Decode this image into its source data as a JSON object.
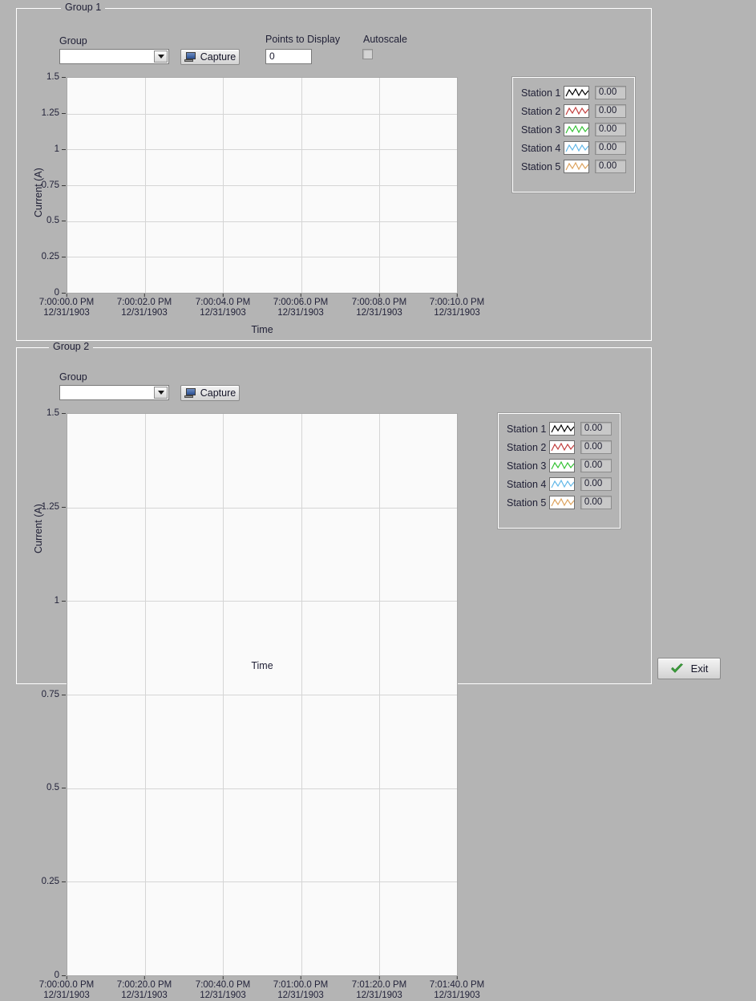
{
  "groups": [
    {
      "frame_label": "Group 1",
      "group_label": "Group",
      "group_value": "",
      "capture_label": "Capture",
      "points_label": "Points to Display",
      "points_value": "0",
      "autoscale_label": "Autoscale",
      "autoscale_checked": false,
      "chart": {
        "ylabel": "Current (A)",
        "xlabel": "Time",
        "yticks": [
          "1.5",
          "1.25",
          "1",
          "0.75",
          "0.5",
          "0.25",
          "0"
        ],
        "xticks": [
          {
            "time": "7:00:00.0 PM",
            "date": "12/31/1903"
          },
          {
            "time": "7:00:02.0 PM",
            "date": "12/31/1903"
          },
          {
            "time": "7:00:04.0 PM",
            "date": "12/31/1903"
          },
          {
            "time": "7:00:06.0 PM",
            "date": "12/31/1903"
          },
          {
            "time": "7:00:08.0 PM",
            "date": "12/31/1903"
          },
          {
            "time": "7:00:10.0 PM",
            "date": "12/31/1903"
          }
        ]
      },
      "legend": [
        {
          "name": "Station 1",
          "color": "#000000",
          "value": "0.00"
        },
        {
          "name": "Station 2",
          "color": "#c3403f",
          "value": "0.00"
        },
        {
          "name": "Station 3",
          "color": "#35c335",
          "value": "0.00"
        },
        {
          "name": "Station 4",
          "color": "#63b8e8",
          "value": "0.00"
        },
        {
          "name": "Station 5",
          "color": "#dda35e",
          "value": "0.00"
        }
      ]
    },
    {
      "frame_label": "Group 2",
      "group_label": "Group",
      "group_value": "",
      "capture_label": "Capture",
      "chart": {
        "ylabel": "Current (A)",
        "xlabel": "Time",
        "yticks": [
          "1.5",
          "1.25",
          "1",
          "0.75",
          "0.5",
          "0.25",
          "0"
        ],
        "xticks": [
          {
            "time": "7:00:00.0 PM",
            "date": "12/31/1903"
          },
          {
            "time": "7:00:20.0 PM",
            "date": "12/31/1903"
          },
          {
            "time": "7:00:40.0 PM",
            "date": "12/31/1903"
          },
          {
            "time": "7:01:00.0 PM",
            "date": "12/31/1903"
          },
          {
            "time": "7:01:20.0 PM",
            "date": "12/31/1903"
          },
          {
            "time": "7:01:40.0 PM",
            "date": "12/31/1903"
          }
        ]
      },
      "legend": [
        {
          "name": "Station 1",
          "color": "#000000",
          "value": "0.00"
        },
        {
          "name": "Station 2",
          "color": "#c3403f",
          "value": "0.00"
        },
        {
          "name": "Station 3",
          "color": "#35c335",
          "value": "0.00"
        },
        {
          "name": "Station 4",
          "color": "#63b8e8",
          "value": "0.00"
        },
        {
          "name": "Station 5",
          "color": "#dda35e",
          "value": "0.00"
        }
      ]
    }
  ],
  "exit_button": {
    "label": "Exit",
    "icon_color": "#3aa03a"
  },
  "chart_data": {
    "type": "line",
    "title": "",
    "xlabel": "Time",
    "ylabel": "Current (A)",
    "ylim": [
      0,
      1.5
    ],
    "yticks": [
      0,
      0.25,
      0.5,
      0.75,
      1,
      1.25,
      1.5
    ],
    "grid": true,
    "legend_position": "right",
    "panels": [
      {
        "name": "Group 1",
        "x": [
          "7:00:00.0 PM",
          "7:00:02.0 PM",
          "7:00:04.0 PM",
          "7:00:06.0 PM",
          "7:00:08.0 PM",
          "7:00:10.0 PM"
        ],
        "x_date": "12/31/1903",
        "series": [
          {
            "name": "Station 1",
            "color": "#000000",
            "values": [],
            "current": 0.0
          },
          {
            "name": "Station 2",
            "color": "#c3403f",
            "values": [],
            "current": 0.0
          },
          {
            "name": "Station 3",
            "color": "#35c335",
            "values": [],
            "current": 0.0
          },
          {
            "name": "Station 4",
            "color": "#63b8e8",
            "values": [],
            "current": 0.0
          },
          {
            "name": "Station 5",
            "color": "#dda35e",
            "values": [],
            "current": 0.0
          }
        ]
      },
      {
        "name": "Group 2",
        "x": [
          "7:00:00.0 PM",
          "7:00:20.0 PM",
          "7:00:40.0 PM",
          "7:01:00.0 PM",
          "7:01:20.0 PM",
          "7:01:40.0 PM"
        ],
        "x_date": "12/31/1903",
        "series": [
          {
            "name": "Station 1",
            "color": "#000000",
            "values": [],
            "current": 0.0
          },
          {
            "name": "Station 2",
            "color": "#c3403f",
            "values": [],
            "current": 0.0
          },
          {
            "name": "Station 3",
            "color": "#35c335",
            "values": [],
            "current": 0.0
          },
          {
            "name": "Station 4",
            "color": "#63b8e8",
            "values": [],
            "current": 0.0
          },
          {
            "name": "Station 5",
            "color": "#dda35e",
            "values": [],
            "current": 0.0
          }
        ]
      }
    ]
  }
}
